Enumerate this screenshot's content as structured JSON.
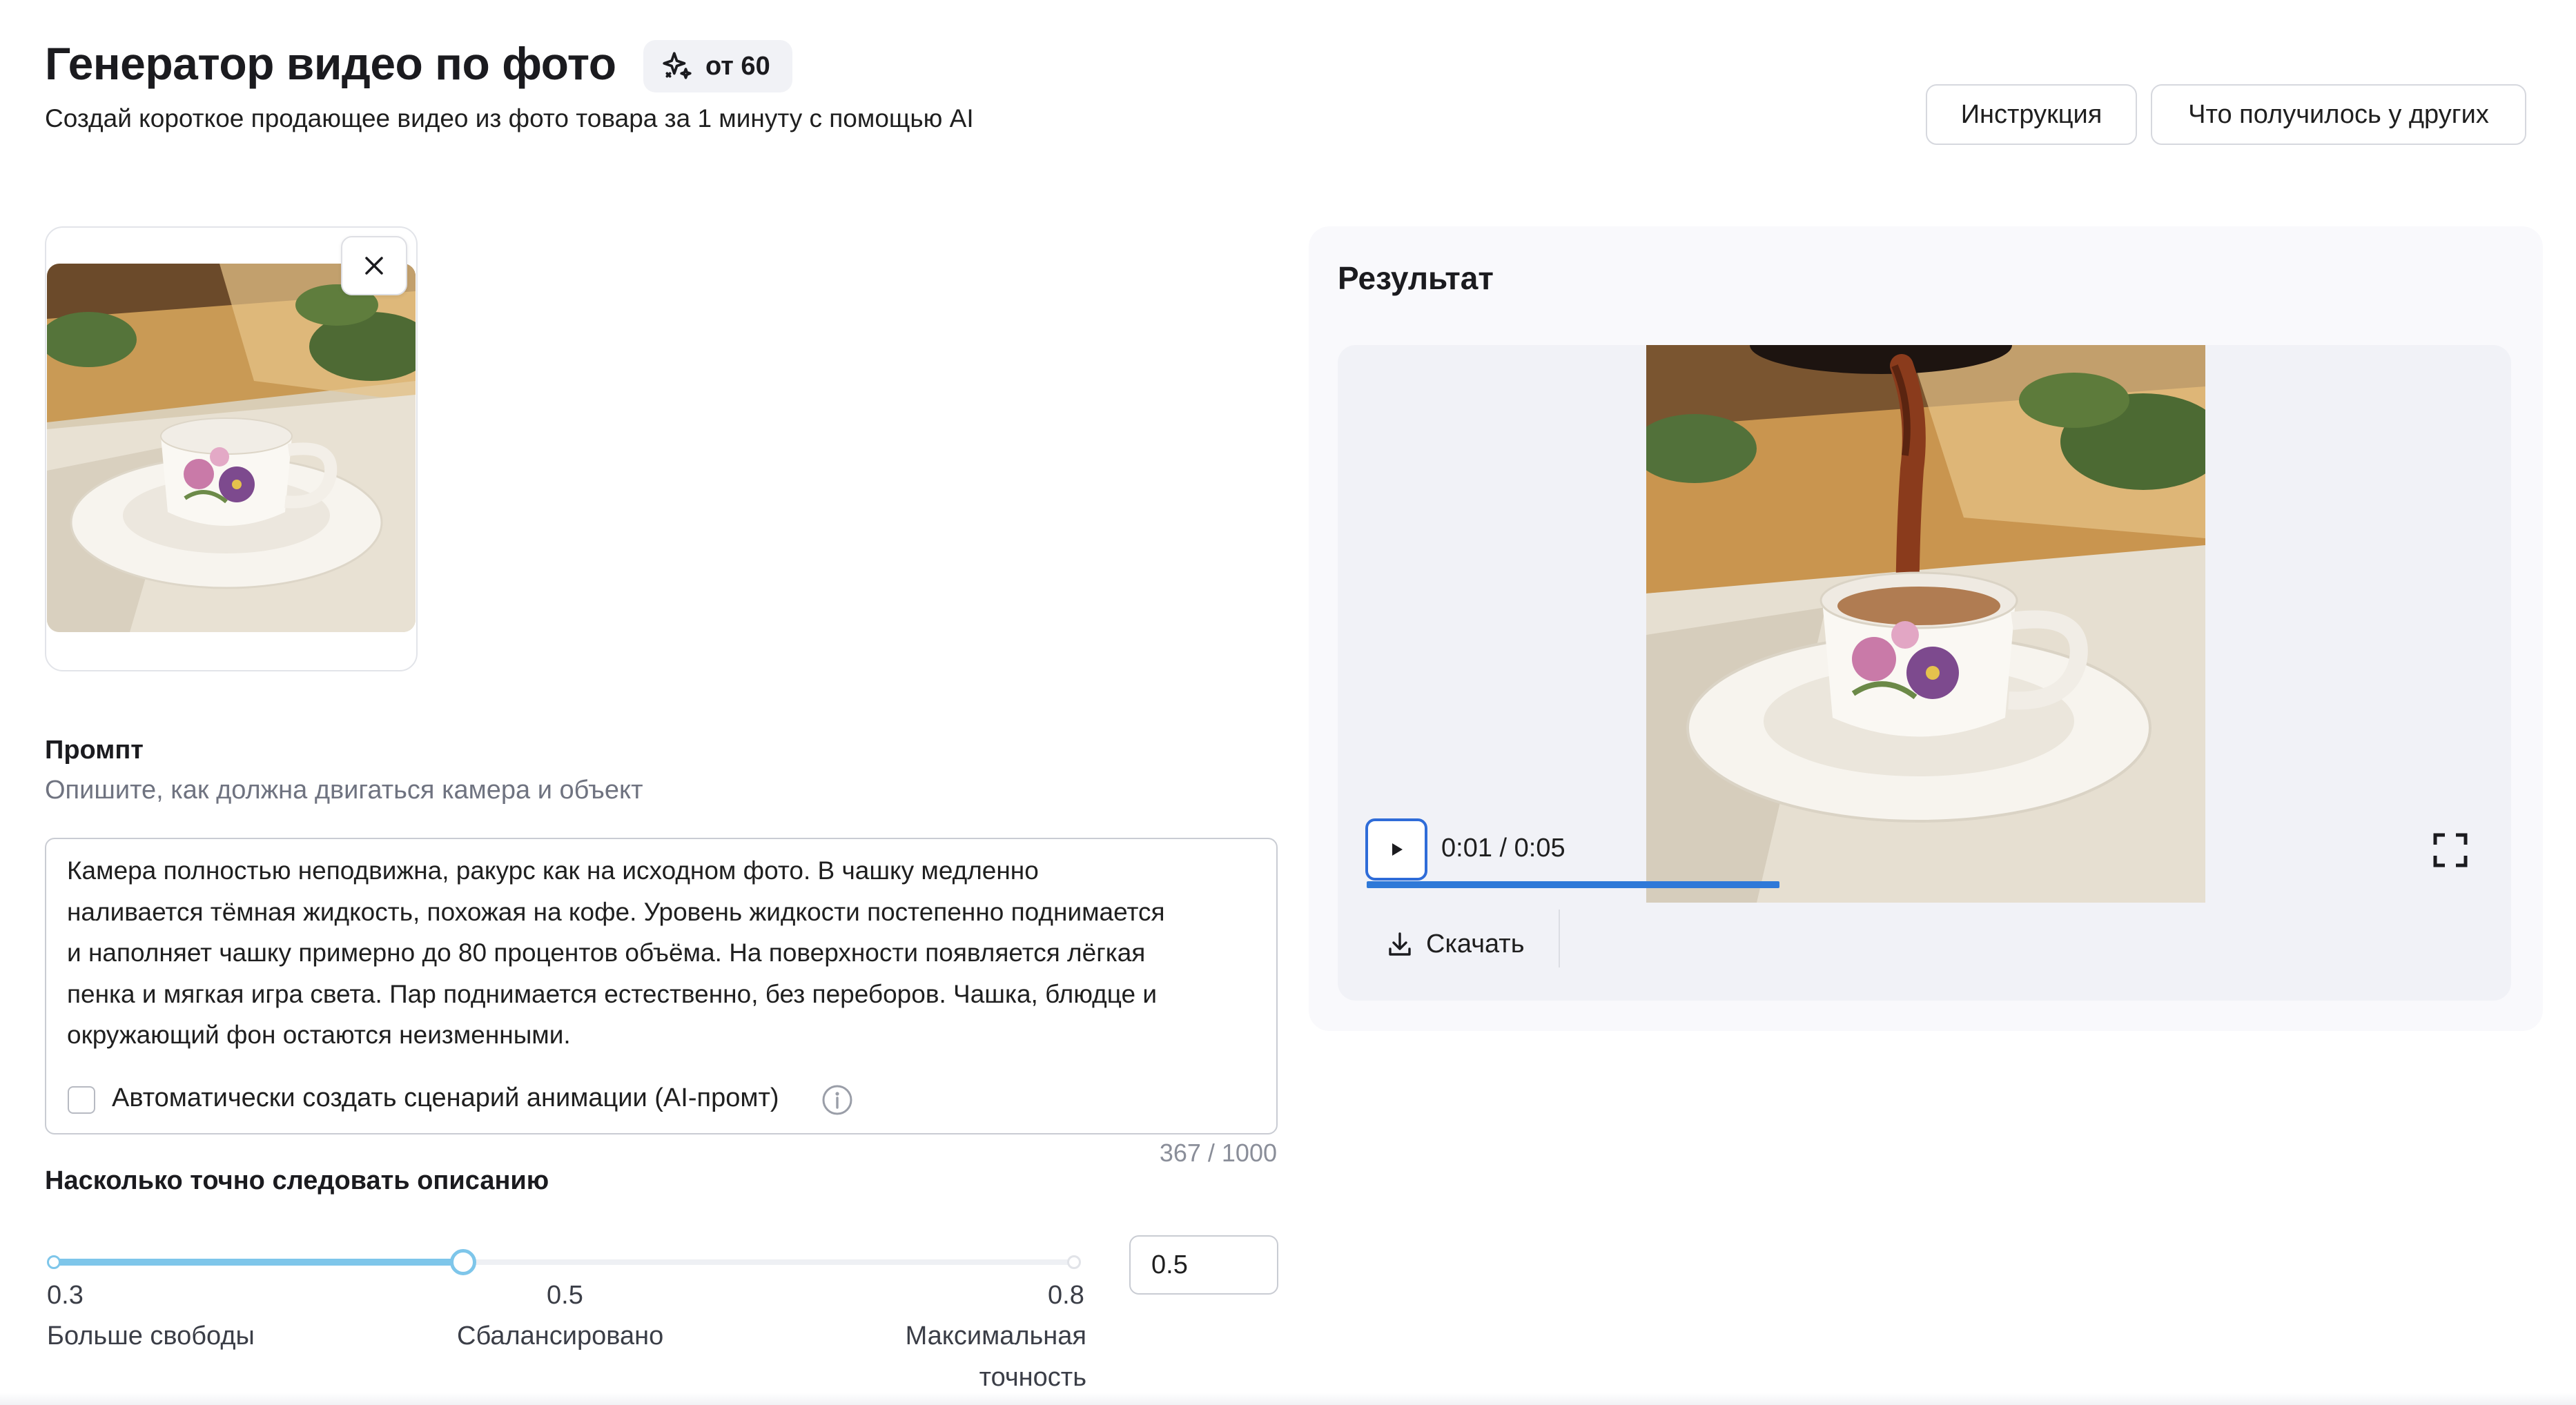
{
  "header": {
    "title": "Генератор видео по фото",
    "cost_badge": "от 60",
    "subtitle": "Создай короткое продающее видео из фото товара за 1 минуту с помощью AI",
    "instruction_button": "Инструкция",
    "others_button": "Что получилось у других"
  },
  "upload": {
    "remove_icon": "close-icon"
  },
  "prompt": {
    "label": "Промпт",
    "hint": "Опишите, как должна двигаться камера и объект",
    "text": "Камера полностью неподвижна, ракурс как на исходном фото. В чашку медленно\nналивается тёмная жидкость, похожая на кофе. Уровень жидкости постепенно поднимается\nи наполняет чашку примерно до 80 процентов объёма. На поверхности появляется лёгкая\nпенка и мягкая игра света. Пар поднимается естественно, без переборов. Чашка, блюдце и\nокружающий фон остаются неизменными.",
    "auto_checkbox_label": "Автоматически создать сценарий анимации (AI-промт)",
    "auto_checked": false,
    "char_count": "367 / 1000"
  },
  "slider": {
    "label": "Насколько точно следовать описанию",
    "min": 0.3,
    "max": 0.8,
    "value": 0.5,
    "min_label": "0.3",
    "mid_label": "0.5",
    "max_label": "0.8",
    "min_caption": "Больше свободы",
    "mid_caption": "Сбалансировано",
    "max_caption_line1": "Максимальная",
    "max_caption_line2": "точность",
    "input_value": "0.5"
  },
  "result": {
    "title": "Результат",
    "time": "0:01 / 0:05",
    "progress": 0.2,
    "download_label": "Скачать"
  },
  "colors": {
    "accent_blue": "#2f79d8",
    "slider_blue": "#7ec6ea",
    "panel_bg": "#f9f9fc"
  }
}
